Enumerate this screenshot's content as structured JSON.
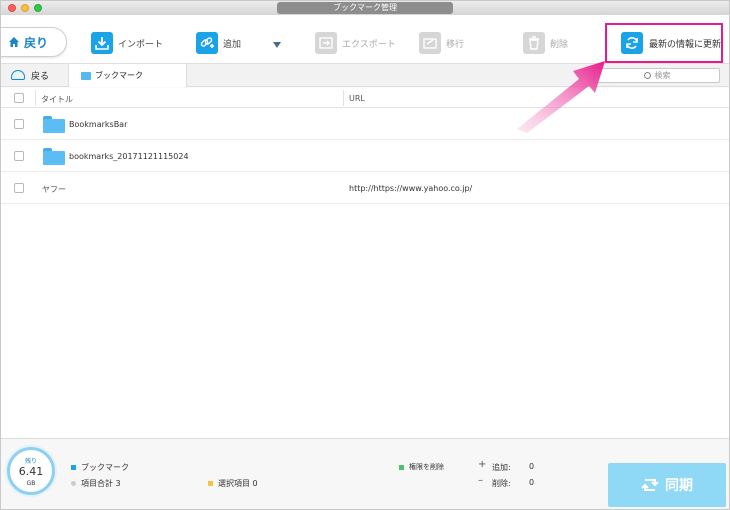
{
  "window": {
    "title": "ブックマーク管理"
  },
  "toolbar": {
    "back_label": "戻り",
    "import_label": "インポート",
    "add_label": "追加",
    "export_label": "エクスポート",
    "migrate_label": "移行",
    "delete_label": "削除",
    "refresh_label": "最新の情報に更新"
  },
  "nav": {
    "back_label": "戻る",
    "breadcrumb": "ブックマーク",
    "search_placeholder": "検索"
  },
  "table": {
    "columns": [
      "タイトル",
      "URL"
    ],
    "rows": [
      {
        "title": "BookmarksBar",
        "url": "",
        "type": "folder"
      },
      {
        "title": "bookmarks_20171121115024",
        "url": "",
        "type": "folder"
      },
      {
        "title": "ヤフー",
        "url": "http://https://www.yahoo.co.jp/",
        "type": "link"
      }
    ]
  },
  "status": {
    "storage_label": "残り",
    "storage_value": "6.41",
    "storage_unit": "GB",
    "legend_bookmark": "ブックマーク",
    "total_items": "項目合計 3",
    "selected_items": "選択項目 0",
    "delete_perm": "権限を削除",
    "add_label": "追加:",
    "add_value": "0",
    "remove_label": "削除:",
    "remove_value": "0",
    "sync_label": "同期"
  },
  "colors": {
    "accent": "#1aa3e6",
    "highlight": "#e8198b",
    "legend_bookmark": "#1aa3e6",
    "legend_total": "#cccccc",
    "legend_selected": "#f5c242",
    "legend_delete_perm": "#4cc36b"
  }
}
